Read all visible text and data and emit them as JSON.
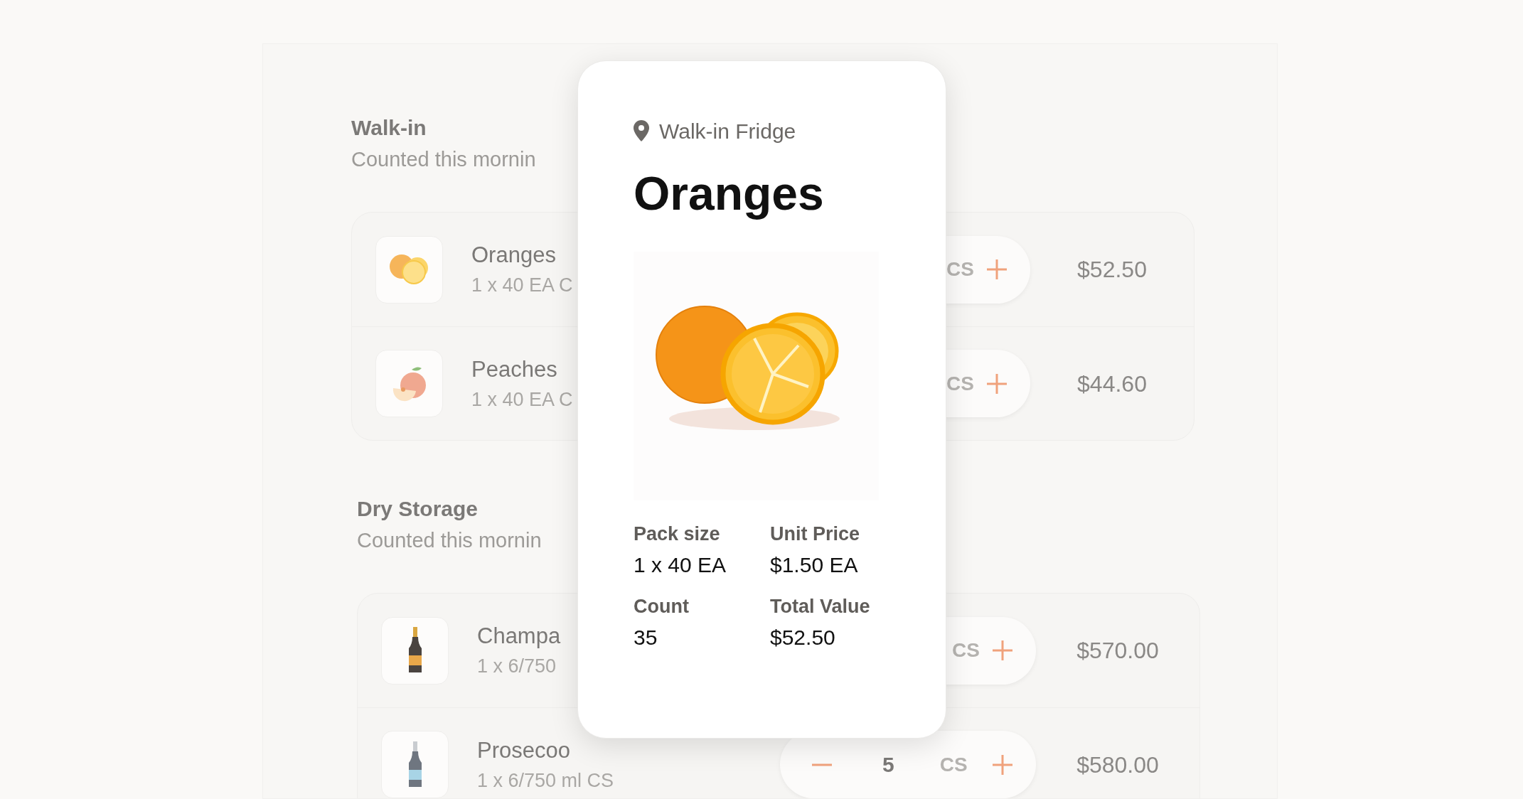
{
  "sections": [
    {
      "title": "Walk-in",
      "subtitle": "Counted this mornin",
      "items": [
        {
          "kind": "oranges",
          "name": "Oranges",
          "pack": "1 x 40 EA C",
          "stepper": {
            "unit": "CS"
          },
          "price": "$52.50"
        },
        {
          "kind": "peach",
          "name": "Peaches",
          "pack": "1 x 40 EA C",
          "stepper": {
            "unit": "CS"
          },
          "price": "$44.60"
        }
      ]
    },
    {
      "title": "Dry Storage",
      "subtitle": "Counted this mornin",
      "items": [
        {
          "kind": "champagne",
          "name": "Champa",
          "pack": "1 x 6/750",
          "stepper": {
            "unit": "CS"
          },
          "price": "$570.00"
        },
        {
          "kind": "prosecco",
          "name": "Prosecoo",
          "pack": "1 x 6/750 ml CS",
          "stepper": {
            "count": "5",
            "unit": "CS"
          },
          "price": "$580.00"
        }
      ]
    }
  ],
  "detail_card": {
    "location": "Walk-in Fridge",
    "title": "Oranges",
    "fields": [
      {
        "label": "Pack size",
        "value": "1 x 40 EA"
      },
      {
        "label": "Unit Price",
        "value": "$1.50 EA"
      },
      {
        "label": "Count",
        "value": "35"
      },
      {
        "label": "Total Value",
        "value": "$52.50"
      }
    ]
  }
}
